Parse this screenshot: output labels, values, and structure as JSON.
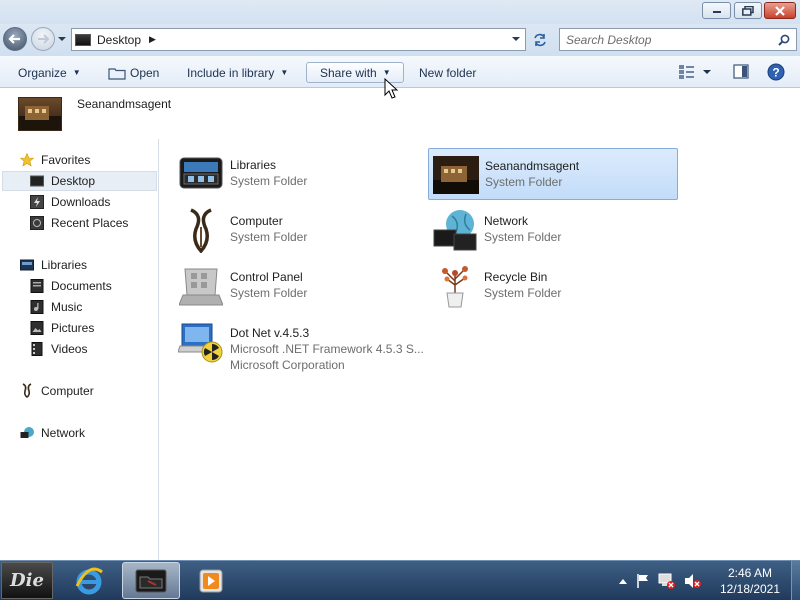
{
  "address": {
    "location": "Desktop",
    "separator": "▶"
  },
  "search": {
    "placeholder": "Search Desktop"
  },
  "toolbar": {
    "organize": "Organize",
    "open": "Open",
    "include_in_library": "Include in library",
    "share_with": "Share with",
    "new_folder": "New folder"
  },
  "details": {
    "name": "Seanandmsagent"
  },
  "nav": {
    "favorites": "Favorites",
    "desktop": "Desktop",
    "downloads": "Downloads",
    "recent_places": "Recent Places",
    "libraries": "Libraries",
    "documents": "Documents",
    "music": "Music",
    "pictures": "Pictures",
    "videos": "Videos",
    "computer": "Computer",
    "network": "Network"
  },
  "items": [
    {
      "name": "Libraries",
      "type": "System Folder"
    },
    {
      "name": "Seanandmsagent",
      "type": "System Folder"
    },
    {
      "name": "Computer",
      "type": "System Folder"
    },
    {
      "name": "Network",
      "type": "System Folder"
    },
    {
      "name": "Control Panel",
      "type": "System Folder"
    },
    {
      "name": "Recycle Bin",
      "type": "System Folder"
    },
    {
      "name": "Dot Net v.4.5.3",
      "type": "Microsoft .NET Framework 4.5.3 S...",
      "publisher": "Microsoft Corporation"
    }
  ],
  "taskbar": {
    "start_label": "Die",
    "time": "2:46 AM",
    "date": "12/18/2021"
  },
  "icons": {
    "back": "back-arrow-icon",
    "forward": "forward-arrow-icon",
    "refresh": "refresh-icon",
    "search": "search-icon",
    "help": "help-icon",
    "views": "views-icon",
    "preview": "preview-pane-icon"
  },
  "colors": {
    "selection": "#c2dcf9",
    "selection_border": "#84acdd",
    "taskbar": "#203a5c"
  }
}
